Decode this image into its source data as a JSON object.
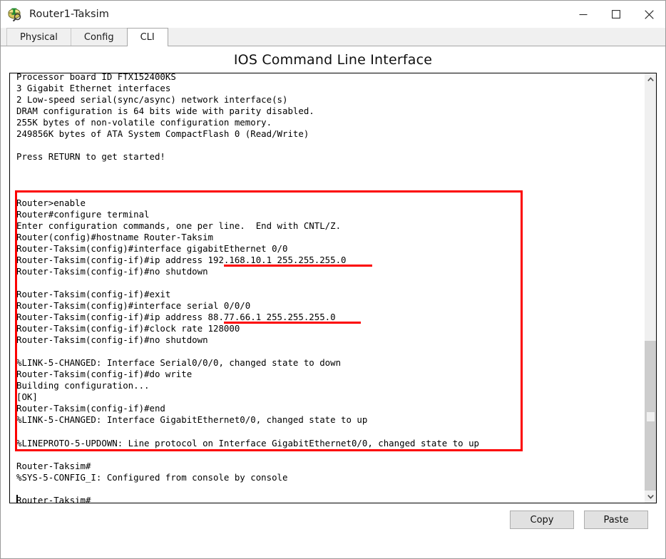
{
  "window": {
    "title": "Router1-Taksim",
    "icon": "router-device-icon",
    "controls": {
      "minimize": "minimize-icon",
      "maximize": "maximize-icon",
      "close": "close-icon"
    }
  },
  "tabs": [
    {
      "label": "Physical",
      "active": false
    },
    {
      "label": "Config",
      "active": false
    },
    {
      "label": "CLI",
      "active": true
    }
  ],
  "panel": {
    "title": "IOS Command Line Interface"
  },
  "terminal": {
    "text": "Processor board ID FTX152400KS\n3 Gigabit Ethernet interfaces\n2 Low-speed serial(sync/async) network interface(s)\nDRAM configuration is 64 bits wide with parity disabled.\n255K bytes of non-volatile configuration memory.\n249856K bytes of ATA System CompactFlash 0 (Read/Write)\n\nPress RETURN to get started!\n\n\n\nRouter>enable\nRouter#configure terminal\nEnter configuration commands, one per line.  End with CNTL/Z.\nRouter(config)#hostname Router-Taksim\nRouter-Taksim(config)#interface gigabitEthernet 0/0\nRouter-Taksim(config-if)#ip address 192.168.10.1 255.255.255.0\nRouter-Taksim(config-if)#no shutdown\n\nRouter-Taksim(config-if)#exit\nRouter-Taksim(config)#interface serial 0/0/0\nRouter-Taksim(config-if)#ip address 88.77.66.1 255.255.255.0\nRouter-Taksim(config-if)#clock rate 128000\nRouter-Taksim(config-if)#no shutdown\n\n%LINK-5-CHANGED: Interface Serial0/0/0, changed state to down\nRouter-Taksim(config-if)#do write\nBuilding configuration...\n[OK]\nRouter-Taksim(config-if)#end\n%LINK-5-CHANGED: Interface GigabitEthernet0/0, changed state to up\n\n%LINEPROTO-5-UPDOWN: Line protocol on Interface GigabitEthernet0/0, changed state to up\n\nRouter-Taksim#\n%SYS-5-CONFIG_I: Configured from console by console\n\nRouter-Taksim#",
    "prompt_hostname": "Router-Taksim",
    "annotations": {
      "highlight_color": "#fc0000",
      "highlighted_block_start": "Router>enable",
      "highlighted_block_end": "%LINEPROTO-5-UPDOWN: Line protocol on Interface GigabitEthernet0/0, changed state to up",
      "underlined_values": [
        "192.168.10.1 255.255.255.0",
        "88.77.66.1 255.255.255.0"
      ]
    },
    "scrollbar": {
      "up_arrow": "chevron-up-icon",
      "down_arrow": "chevron-down-icon"
    }
  },
  "footer": {
    "copy_label": "Copy",
    "paste_label": "Paste"
  }
}
